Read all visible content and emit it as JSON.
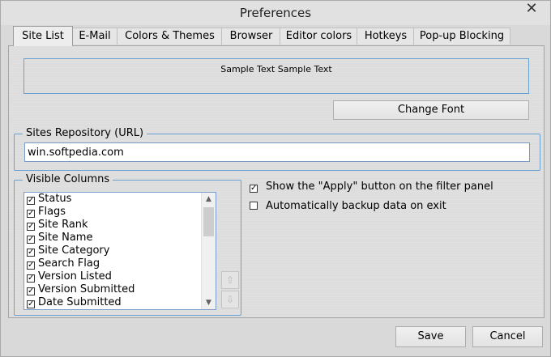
{
  "window": {
    "title": "Preferences",
    "close_glyph": "✕"
  },
  "tabs": [
    {
      "label": "Site List"
    },
    {
      "label": "E-Mail"
    },
    {
      "label": "Colors & Themes"
    },
    {
      "label": "Browser"
    },
    {
      "label": "Editor colors"
    },
    {
      "label": "Hotkeys"
    },
    {
      "label": "Pop-up Blocking"
    }
  ],
  "font": {
    "sample_text": "Sample Text Sample Text",
    "change_font_label": "Change Font"
  },
  "repository": {
    "legend": "Sites Repository (URL)",
    "value": "win.softpedia.com"
  },
  "columns": {
    "legend": "Visible Columns",
    "items": [
      {
        "label": "Status",
        "checked": true
      },
      {
        "label": "Flags",
        "checked": true
      },
      {
        "label": "Site Rank",
        "checked": true
      },
      {
        "label": "Site Name",
        "checked": true
      },
      {
        "label": "Site Category",
        "checked": true
      },
      {
        "label": "Search Flag",
        "checked": true
      },
      {
        "label": "Version Listed",
        "checked": true
      },
      {
        "label": "Version Submitted",
        "checked": true
      },
      {
        "label": "Date Submitted",
        "checked": true
      }
    ],
    "check_glyph": "✓"
  },
  "options": {
    "show_apply": {
      "label": "Show the \"Apply\" button on the filter panel",
      "checked": true
    },
    "auto_backup": {
      "label": "Automatically backup data on exit",
      "checked": false
    }
  },
  "footer": {
    "save_label": "Save",
    "cancel_label": "Cancel"
  }
}
